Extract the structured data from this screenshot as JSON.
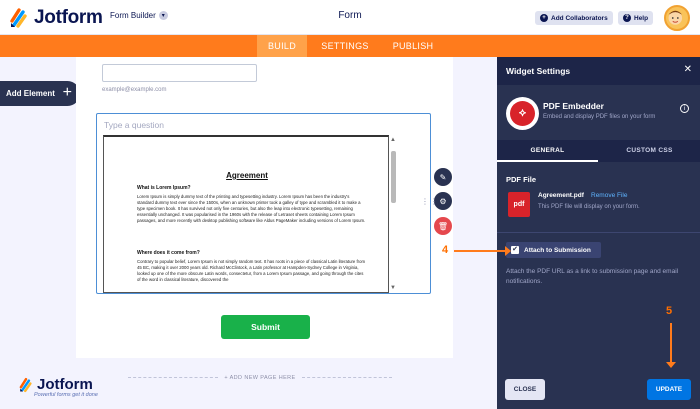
{
  "header": {
    "brand": "Jotform",
    "form_builder": "Form Builder",
    "form_title": "Form",
    "add_collaborators": "Add Collaborators",
    "help": "Help"
  },
  "nav": {
    "tabs": [
      "BUILD",
      "SETTINGS",
      "PUBLISH"
    ],
    "active": "BUILD"
  },
  "canvas": {
    "add_element": "Add Element",
    "email_hint": "example@example.com",
    "question_placeholder": "Type a question",
    "submit": "Submit",
    "add_new_page": "+ ADD NEW PAGE HERE"
  },
  "pdf_preview": {
    "title": "Agreement",
    "heading1": "What is Lorem Ipsum?",
    "para1": "Lorem Ipsum is simply dummy text of the printing and typesetting industry. Lorem Ipsum has been the industry's standard dummy text ever since the 1500s, when an unknown printer took a galley of type and scrambled it to make a type specimen book. It has survived not only five centuries, but also the leap into electronic typesetting, remaining essentially unchanged. It was popularised in the 1960s with the release of Letraset sheets containing Lorem Ipsum passages, and more recently with desktop publishing software like Aldus PageMaker including versions of Lorem Ipsum.",
    "heading2": "Where does it come from?",
    "para2": "Contrary to popular belief, Lorem Ipsum is not simply random text. It has roots in a piece of classical Latin literature from 45 BC, making it over 2000 years old. Richard McClintock, a Latin professor at Hampden-Sydney College in Virginia, looked up one of the more obscure Latin words, consectetur, from a Lorem Ipsum passage, and going through the cites of the word in classical literature, discovered the"
  },
  "watermark": {
    "brand": "Jotform",
    "tagline": "Powerful forms get it done"
  },
  "panel": {
    "title": "Widget Settings",
    "widget_name": "PDF Embedder",
    "widget_desc": "Embed and display PDF files on your form",
    "tabs": [
      "GENERAL",
      "CUSTOM CSS"
    ],
    "pdf_file_label": "PDF File",
    "pdf_badge": "pdf",
    "file_name": "Agreement.pdf",
    "remove_file": "Remove File",
    "file_note": "This PDF file will display on your form.",
    "attach_label": "Attach to Submission",
    "attach_checked": true,
    "attach_desc": "Attach the PDF URL as a link to submission page and email notifications.",
    "close": "CLOSE",
    "update": "UPDATE"
  },
  "annotations": {
    "step4": "4",
    "step5": "5"
  },
  "colors": {
    "orange": "#ff7b1c",
    "panel": "#293251",
    "accent_blue": "#0075e3",
    "submit_green": "#19b14a",
    "pdf_red": "#d8232a"
  }
}
